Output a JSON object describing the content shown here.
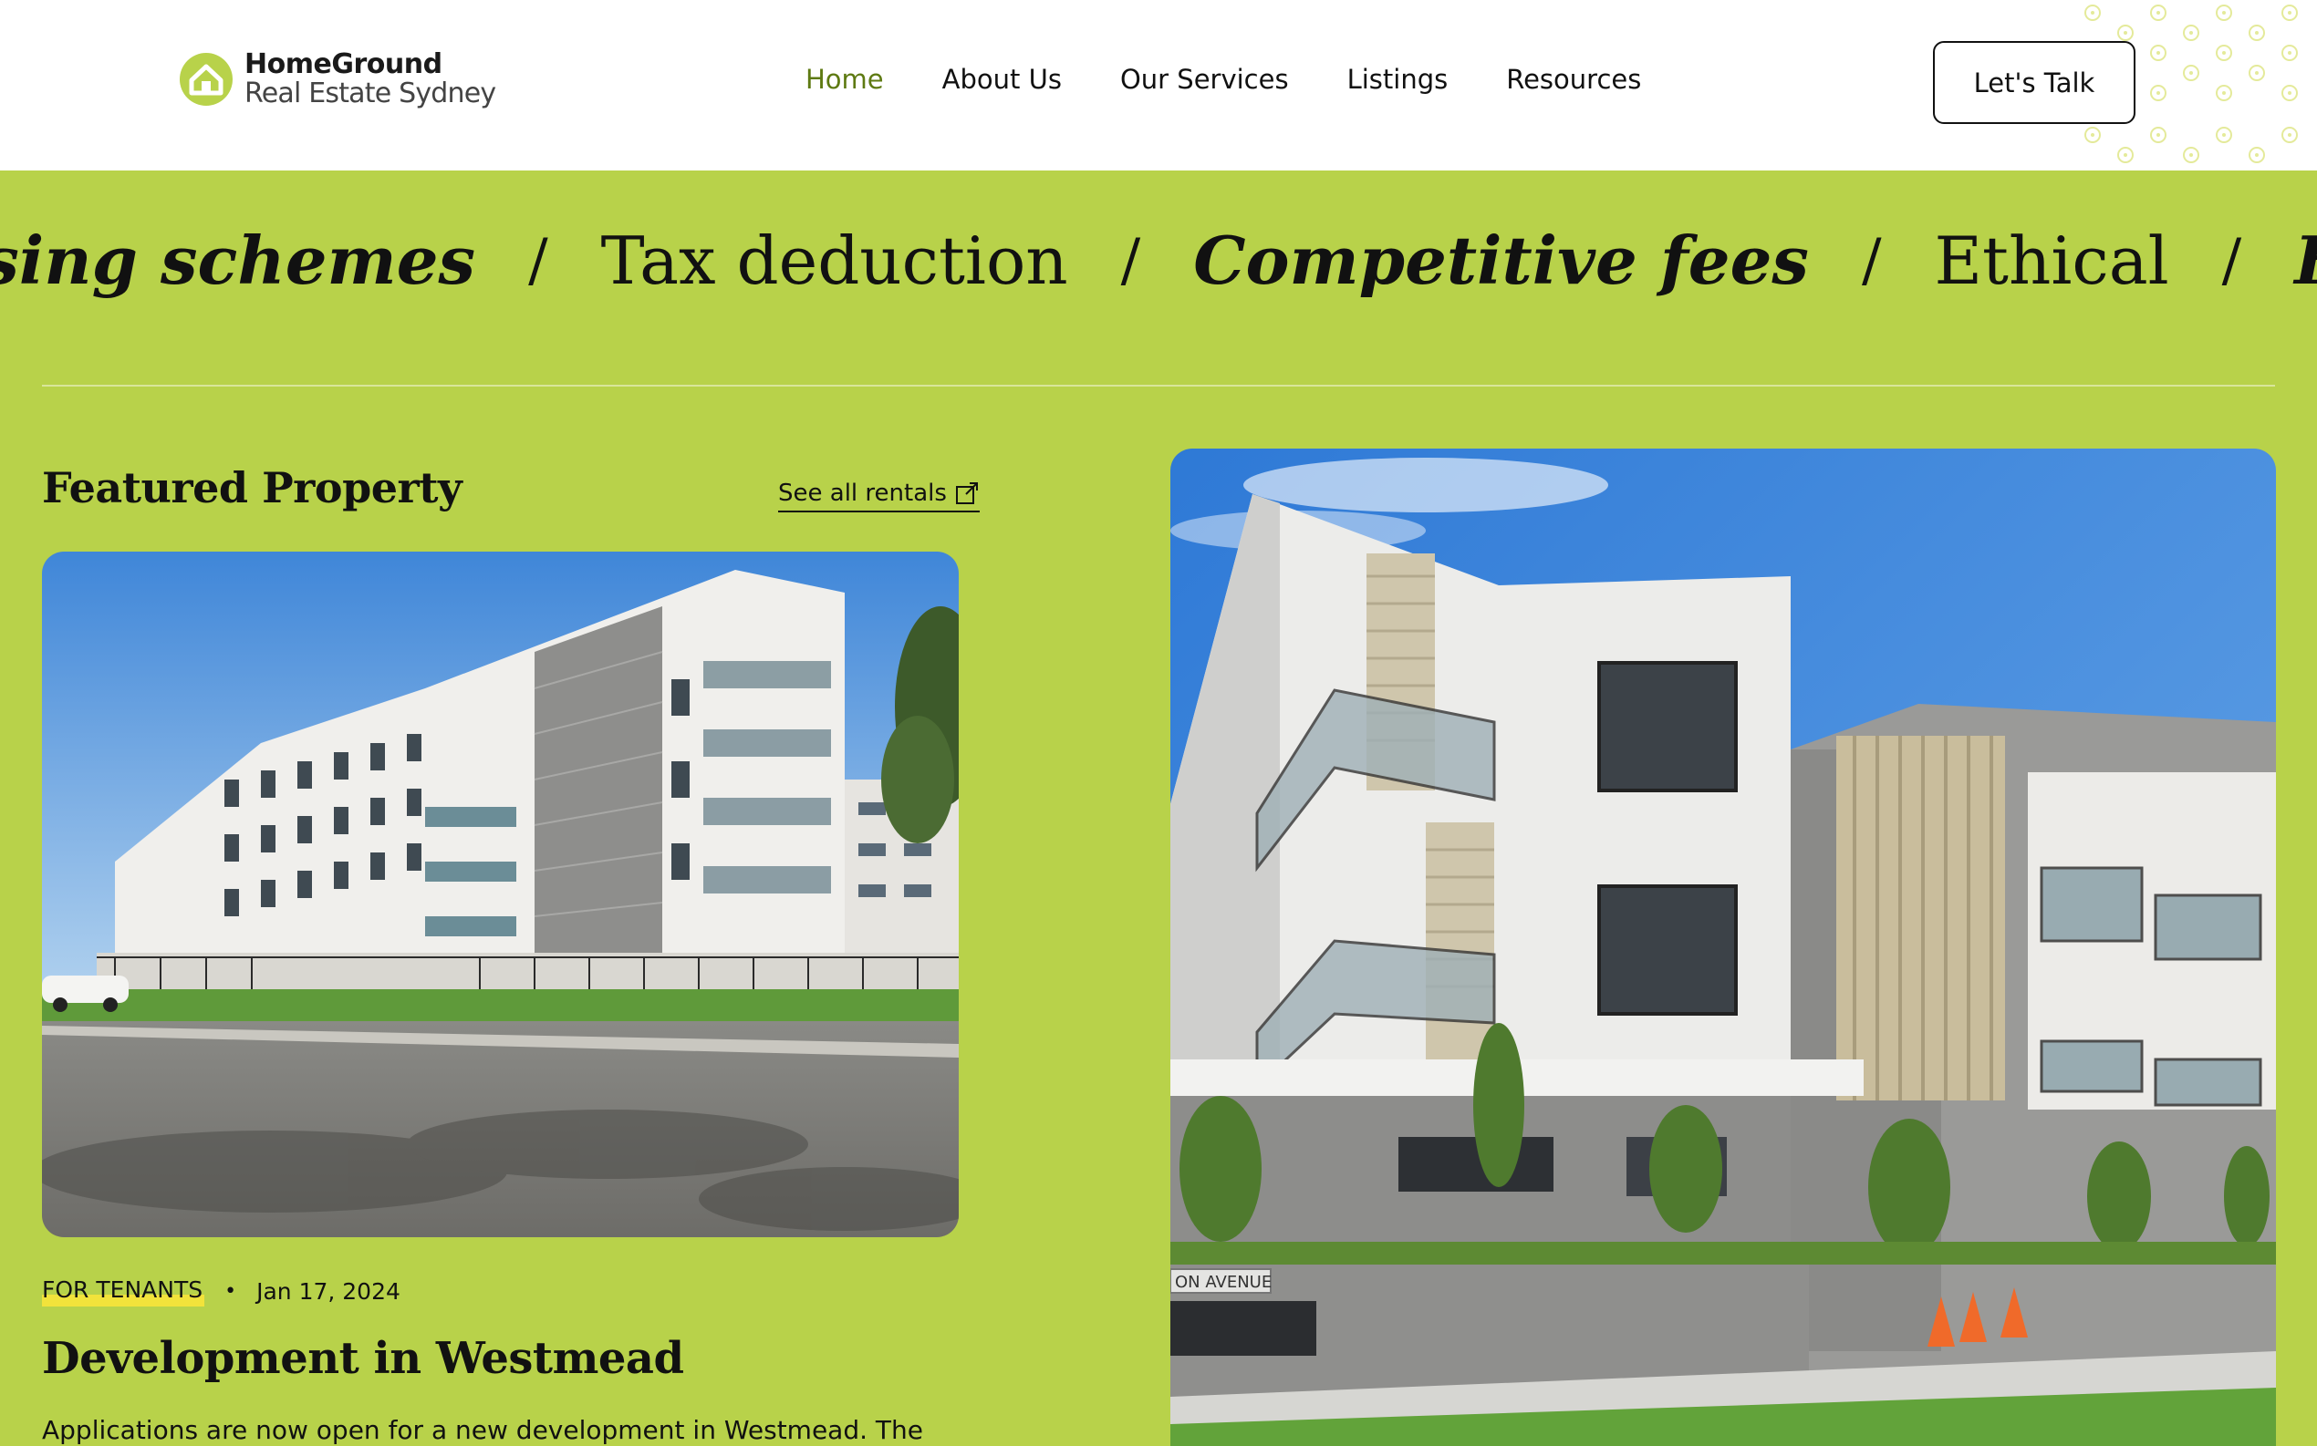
{
  "brand": {
    "name_line1": "HomeGround",
    "name_line2": "Real Estate Sydney",
    "accent_color": "#b8d24a",
    "logo_icon": "house-icon"
  },
  "nav": {
    "items": [
      {
        "label": "Home",
        "active": true
      },
      {
        "label": "About Us",
        "active": false
      },
      {
        "label": "Our Services",
        "active": false
      },
      {
        "label": "Listings",
        "active": false
      },
      {
        "label": "Resources",
        "active": false
      }
    ],
    "cta_label": "Let's Talk"
  },
  "marquee": {
    "items": [
      {
        "text": "ousing schemes",
        "style": "bold-italic"
      },
      {
        "text": "Tax deduction",
        "style": "regular"
      },
      {
        "text": "Competitive fees",
        "style": "bold-italic"
      },
      {
        "text": "Ethical",
        "style": "regular"
      },
      {
        "text": "Help commu",
        "style": "bold-italic"
      }
    ],
    "separator": "/"
  },
  "featured": {
    "title": "Featured Property",
    "see_all_label": "See all rentals",
    "see_all_icon": "external-link-icon",
    "post": {
      "tag": "FOR TENANTS",
      "bullet": "•",
      "date": "Jan 17, 2024",
      "title": "Development in Westmead",
      "excerpt": "Applications are now open for a new development in Westmead. The"
    },
    "hero_sign": "ON AVENUE"
  }
}
